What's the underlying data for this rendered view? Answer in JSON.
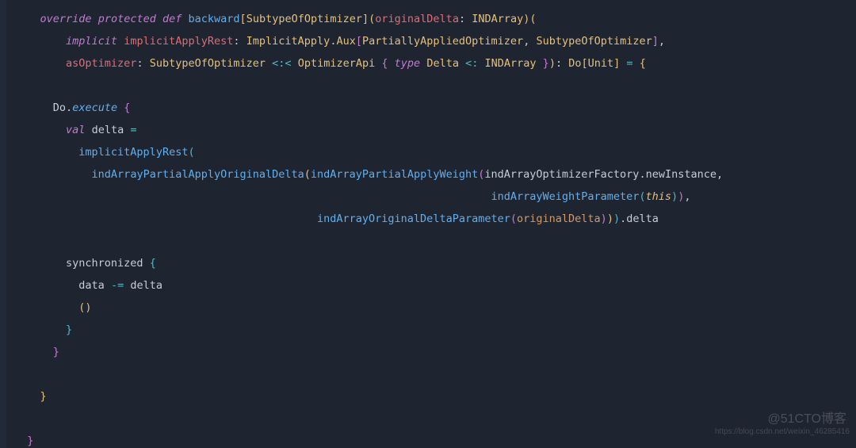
{
  "code": {
    "line1": {
      "kw_override": "override",
      "kw_protected": "protected",
      "kw_def": "def",
      "fn_name": "backward",
      "type_param": "SubtypeOfOptimizer",
      "param_name": "originalDelta",
      "param_type": "INDArray"
    },
    "line2": {
      "kw_implicit": "implicit",
      "param_name": "implicitApplyRest",
      "type1": "ImplicitApply",
      "type2": "Aux",
      "type3": "PartiallyAppliedOptimizer",
      "type4": "SubtypeOfOptimizer"
    },
    "line3": {
      "param_name": "asOptimizer",
      "type1": "SubtypeOfOptimizer",
      "op": "<:<",
      "type2": "OptimizerApi",
      "kw_type": "type",
      "type3": "Delta",
      "op2": "<:",
      "type4": "INDArray",
      "type5": "Do",
      "type6": "Unit",
      "op3": "="
    },
    "line5": {
      "obj": "Do",
      "method": "execute"
    },
    "line6": {
      "kw_val": "val",
      "name": "delta",
      "op": "="
    },
    "line7": {
      "fn": "implicitApplyRest"
    },
    "line8": {
      "fn1": "indArrayPartialApplyOriginalDelta",
      "fn2": "indArrayPartialApplyWeight",
      "ident": "indArrayOptimizerFactory",
      "fn3": "newInstance"
    },
    "line9": {
      "fn": "indArrayWeightParameter",
      "kw_this": "this"
    },
    "line10": {
      "fn": "indArrayOriginalDeltaParameter",
      "arg": "originalDelta",
      "tail": "delta"
    },
    "line12": {
      "ident": "synchronized"
    },
    "line13": {
      "ident1": "data",
      "op": "-=",
      "ident2": "delta"
    }
  },
  "watermark1": "@51CTO博客",
  "watermark2": "https://blog.csdn.net/weixin_46285416"
}
